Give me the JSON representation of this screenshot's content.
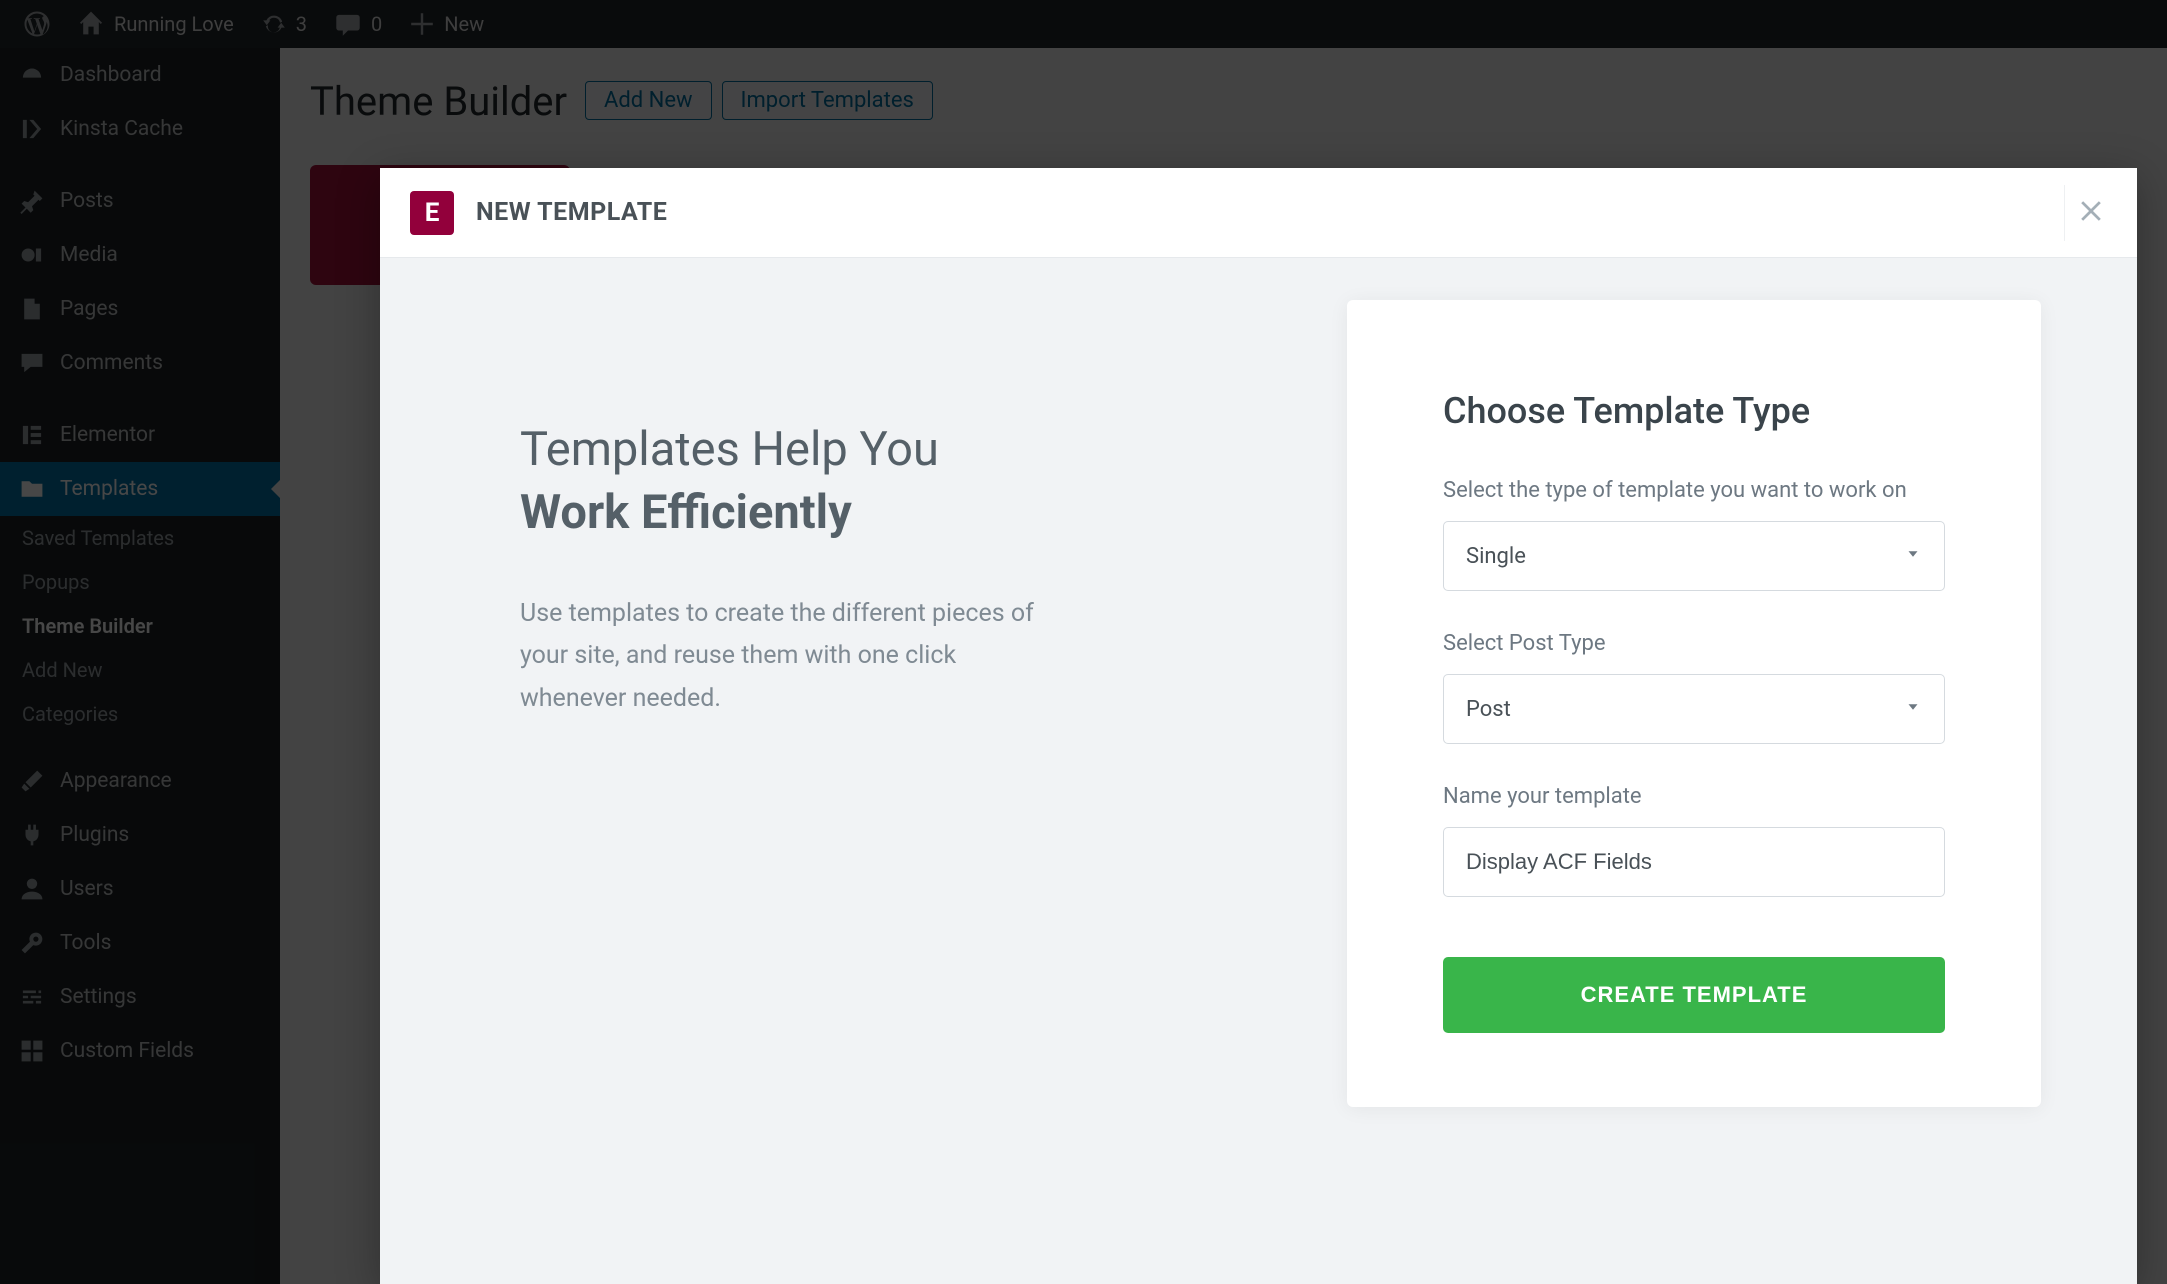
{
  "adminbar": {
    "site_name": "Running Love",
    "updates_count": "3",
    "comments_count": "0",
    "new_label": "New"
  },
  "sidebar": {
    "items": [
      {
        "label": "Dashboard",
        "icon": "dashboard"
      },
      {
        "label": "Kinsta Cache",
        "icon": "kinsta"
      },
      {
        "label": "Posts",
        "icon": "pin"
      },
      {
        "label": "Media",
        "icon": "media"
      },
      {
        "label": "Pages",
        "icon": "page"
      },
      {
        "label": "Comments",
        "icon": "comment"
      },
      {
        "label": "Elementor",
        "icon": "elementor"
      },
      {
        "label": "Templates",
        "icon": "folder",
        "current": true
      },
      {
        "label": "Appearance",
        "icon": "brush"
      },
      {
        "label": "Plugins",
        "icon": "plug"
      },
      {
        "label": "Users",
        "icon": "user"
      },
      {
        "label": "Tools",
        "icon": "wrench"
      },
      {
        "label": "Settings",
        "icon": "sliders"
      },
      {
        "label": "Custom Fields",
        "icon": "grid"
      }
    ],
    "subitems": [
      {
        "label": "Saved Templates"
      },
      {
        "label": "Popups"
      },
      {
        "label": "Theme Builder",
        "active": true
      },
      {
        "label": "Add New"
      },
      {
        "label": "Categories"
      }
    ]
  },
  "main": {
    "page_title": "Theme Builder",
    "btn_add_new": "Add New",
    "btn_import": "Import Templates"
  },
  "modal": {
    "header_title": "NEW TEMPLATE",
    "logo_letter": "E",
    "left_heading_line1": "Templates Help You",
    "left_heading_line2": "Work Efficiently",
    "left_paragraph": "Use templates to create the different pieces of your site, and reuse them with one click whenever needed.",
    "card_title": "Choose Template Type",
    "field1_label": "Select the type of template you want to work on",
    "field1_value": "Single",
    "field2_label": "Select Post Type",
    "field2_value": "Post",
    "field3_label": "Name your template",
    "field3_value": "Display ACF Fields",
    "create_button": "CREATE TEMPLATE"
  }
}
